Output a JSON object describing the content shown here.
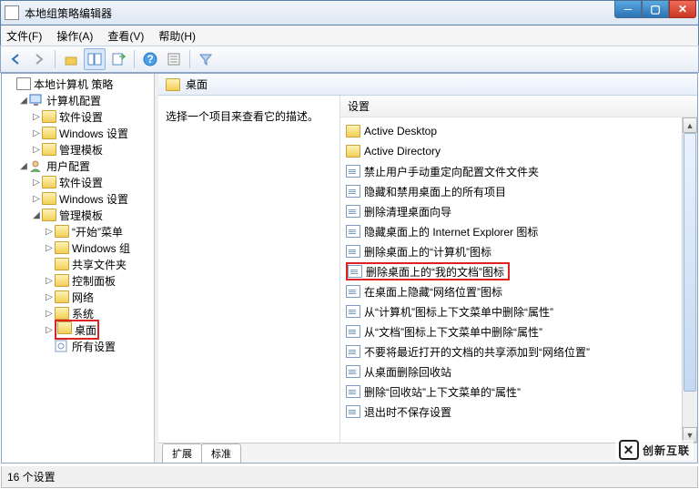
{
  "window": {
    "title": "本地组策略编辑器"
  },
  "menu": {
    "file": "文件(F)",
    "action": "操作(A)",
    "view": "查看(V)",
    "help": "帮助(H)"
  },
  "tree": {
    "root": "本地计算机 策略",
    "computer": "计算机配置",
    "comp_software": "软件设置",
    "comp_windows": "Windows 设置",
    "comp_admin": "管理模板",
    "user": "用户配置",
    "user_software": "软件设置",
    "user_windows": "Windows 设置",
    "user_admin": "管理模板",
    "start_menu": "“开始”菜单",
    "windows_comp": "Windows 组",
    "shared": "共享文件夹",
    "control_panel": "控制面板",
    "network": "网络",
    "system": "系统",
    "desktop": "桌面",
    "all_settings": "所有设置"
  },
  "main": {
    "header_title": "桌面",
    "description": "选择一个项目来查看它的描述。",
    "column_header": "设置",
    "items": [
      "Active Desktop",
      "Active Directory",
      "禁止用户手动重定向配置文件文件夹",
      "隐藏和禁用桌面上的所有项目",
      "删除清理桌面向导",
      "隐藏桌面上的 Internet Explorer 图标",
      "删除桌面上的“计算机”图标",
      "删除桌面上的“我的文档”图标",
      "在桌面上隐藏“网络位置”图标",
      "从“计算机”图标上下文菜单中删除“属性”",
      "从“文档”图标上下文菜单中删除“属性”",
      "不要将最近打开的文档的共享添加到“网络位置”",
      "从桌面删除回收站",
      "删除“回收站”上下文菜单的“属性”",
      "退出时不保存设置"
    ],
    "highlight_index": 7
  },
  "tabs": {
    "extended": "扩展",
    "standard": "标准"
  },
  "status": {
    "text": "16 个设置"
  },
  "watermark": {
    "text": "创新互联"
  }
}
